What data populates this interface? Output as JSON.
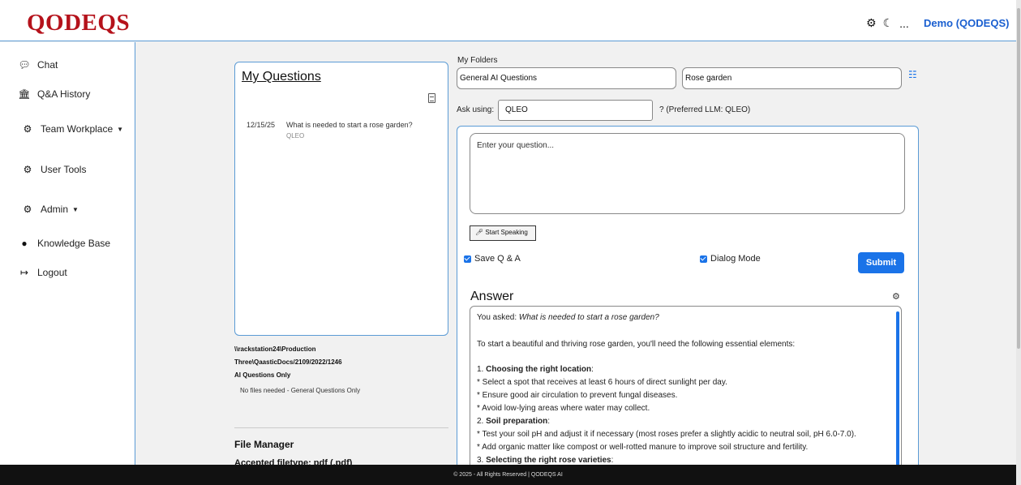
{
  "header": {
    "logo_text": "QODEQS",
    "settings_icon": "gear-icon",
    "theme_icon": "moon-icon",
    "more_label": "...",
    "user_label": "Demo (QODEQS)"
  },
  "sidebar": {
    "items": [
      {
        "label": "Chat",
        "icon": "chat-bubble-icon"
      },
      {
        "label": "Q&A History",
        "icon": "bank-icon"
      },
      {
        "label": "Team Workplace",
        "icon": "gears-icon"
      },
      {
        "label": "User Tools",
        "icon": "gears-icon"
      },
      {
        "label": "Admin",
        "icon": "gears-icon"
      },
      {
        "label": "Knowledge Base",
        "icon": "brain-icon"
      },
      {
        "label": "Logout",
        "icon": "logout-icon"
      }
    ]
  },
  "questions": {
    "title": "My Questions",
    "items": [
      {
        "date": "12/15/25",
        "text": "What is needed to start a rose garden?",
        "llm": "QLEO"
      }
    ]
  },
  "storage": {
    "path_line1": "\\\\rackstation24\\Production",
    "path_line2": "Three\\QaasticDocs/2109/2022/1246",
    "scope": "AI Questions Only",
    "files_note": "No files needed - General Questions Only",
    "file_manager_title": "File Manager",
    "accepted_label": "Accepted filetype: pdf (.pdf)"
  },
  "folders": {
    "label": "My Folders",
    "folder1": "General AI Questions",
    "folder2": "Rose garden"
  },
  "ask": {
    "label": "Ask using:",
    "value": "QLEO",
    "preferred": "? (Preferred LLM: QLEO)"
  },
  "question_form": {
    "placeholder": "Enter your question...",
    "speak_label": "Start Speaking",
    "save_label": "Save Q & A",
    "dialog_label": "Dialog Mode",
    "submit_label": "Submit",
    "save_checked": true,
    "dialog_checked": true
  },
  "answer": {
    "title": "Answer",
    "asked_prefix": "You asked: ",
    "asked_question": "What is needed to start a rose garden?",
    "intro": "To start a beautiful and thriving rose garden, you'll need the following essential elements:",
    "s1_num": "1. ",
    "s1_title": "Choosing the right location",
    "s1_b1": "* Select a spot that receives at least 6 hours of direct sunlight per day.",
    "s1_b2": "* Ensure good air circulation to prevent fungal diseases.",
    "s1_b3": "* Avoid low-lying areas where water may collect.",
    "s2_num": "2. ",
    "s2_title": "Soil preparation",
    "s2_b1": "* Test your soil pH and adjust it if necessary (most roses prefer a slightly acidic to neutral soil, pH 6.0-7.0).",
    "s2_b2": "* Add organic matter like compost or well-rotted manure to improve soil structure and fertility.",
    "s3_num": "3. ",
    "s3_title": "Selecting the right rose varieties"
  },
  "footer": {
    "text": "© 2025 - All Rights Reserved | QODEQS AI"
  },
  "colors": {
    "brand_red": "#b5121b",
    "accent_blue": "#1a73e8",
    "panel_border": "#5b9bd5",
    "footer_bg": "#111111"
  }
}
